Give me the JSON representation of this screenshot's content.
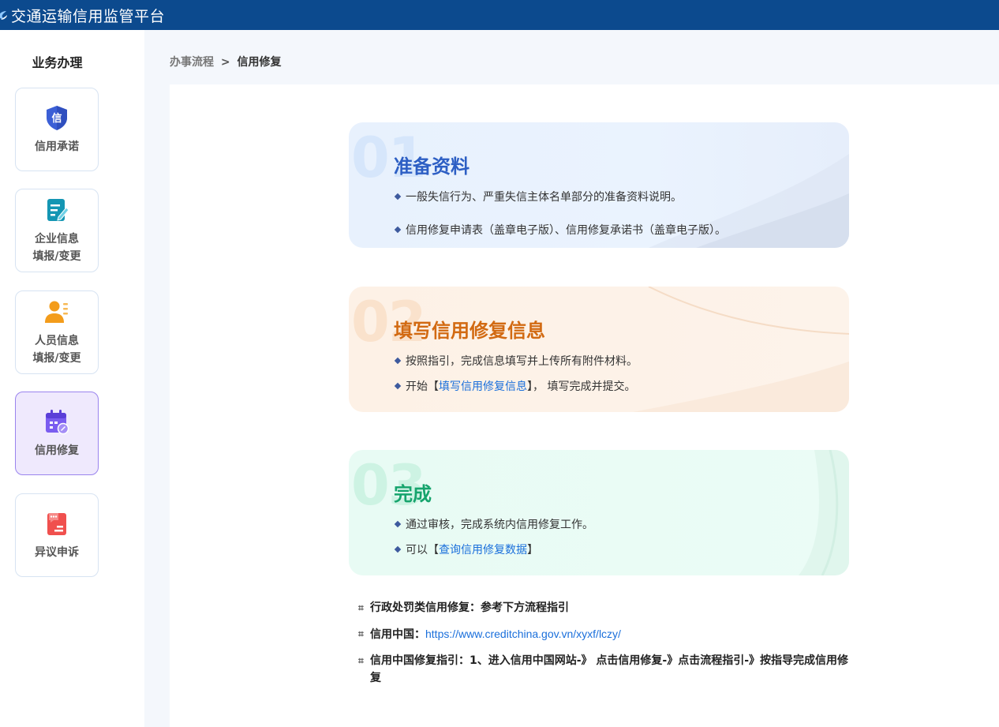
{
  "header": {
    "title": "交通运输信用监管平台",
    "bg_color": "#0c4a8e"
  },
  "sidebar": {
    "title": "业务办理",
    "items": [
      {
        "label": "信用承诺",
        "icon": "shield-xin-icon",
        "color": "#3b5fd6",
        "active": false
      },
      {
        "label": "企业信息\n填报/变更",
        "icon": "document-edit-icon",
        "color": "#1496b3",
        "active": false
      },
      {
        "label": "人员信息\n填报/变更",
        "icon": "person-list-icon",
        "color": "#f39c1b",
        "active": false
      },
      {
        "label": "信用修复",
        "icon": "calendar-repair-icon",
        "color": "#7a5cf0",
        "active": true
      },
      {
        "label": "异议申诉",
        "icon": "chat-document-icon",
        "color": "#f0504e",
        "active": false
      }
    ]
  },
  "breadcrumb": {
    "parent": "办事流程",
    "separator": ">",
    "current": "信用修复"
  },
  "steps": [
    {
      "number": "01",
      "title": "准备资料",
      "lines": [
        {
          "text": "一般失信行为、严重失信主体名单部分的准备资料说明。"
        },
        {
          "text": "信用修复申请表（盖章电子版）、信用修复承诺书（盖章电子版）。"
        }
      ]
    },
    {
      "number": "02",
      "title": "填写信用修复信息",
      "lines": [
        {
          "text": "按照指引，完成信息填写并上传所有附件材料。"
        },
        {
          "prefix": "开始【",
          "link": "填写信用修复信息",
          "suffix": "】，  填写完成并提交。"
        }
      ]
    },
    {
      "number": "03",
      "title": "完成",
      "lines": [
        {
          "text": "通过审核，完成系统内信用修复工作。"
        },
        {
          "prefix": "可以【",
          "link": "查询信用修复数据",
          "suffix": "】"
        }
      ]
    }
  ],
  "notes": [
    {
      "text": "行政处罚类信用修复：参考下方流程指引"
    },
    {
      "label": "信用中国：",
      "link": "https://www.creditchina.gov.vn/xyxf/lczy/"
    },
    {
      "text": "信用中国修复指引：1、进入信用中国网站-》 点击信用修复-》点击流程指引-》按指导完成信用修复"
    }
  ]
}
